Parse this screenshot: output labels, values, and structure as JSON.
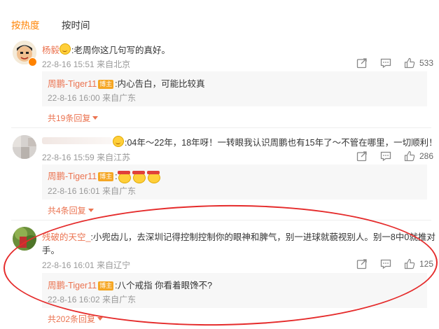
{
  "tabs": {
    "hot": "按热度",
    "time": "按时间"
  },
  "comments": [
    {
      "user": "杨毅",
      "text": ":老周你这几句写的真好。",
      "time": "22-8-16 15:51",
      "location": "来自北京",
      "likes": "533",
      "reply": {
        "user": "周鹏-Tiger11",
        "badge": "博主",
        "text": ":内心告白，可能比较真",
        "time": "22-8-16 16:00",
        "location": "来自广东"
      },
      "more": "共19条回复"
    },
    {
      "user": "",
      "text": ":04年～22年，18年呀！一转眼我认识周鹏也有15年了～不管在哪里，一切顺利！",
      "time": "22-8-16 15:59",
      "location": "来自江苏",
      "likes": "286",
      "reply": {
        "user": "周鹏-Tiger11",
        "badge": "博主",
        "text": ":",
        "time": "22-8-16 16:01",
        "location": "来自广东"
      },
      "more": "共4条回复"
    },
    {
      "user": "残破的天空_",
      "text": ":小兜齿儿，去深圳记得控制控制你的眼神和脾气，别一进球就藐视别人。别一8中0就推对",
      "text2": "手。",
      "time": "22-8-16 16:01",
      "location": "来自辽宁",
      "likes": "125",
      "reply": {
        "user": "周鹏-Tiger11",
        "badge": "博主",
        "text": ":八个戒指  你看着眼馋不?",
        "time": "22-8-16 16:02",
        "location": "来自广东"
      },
      "more": "共202条回复"
    }
  ],
  "icons": {
    "share": "share-icon",
    "comment": "comment-icon",
    "like": "like-icon"
  },
  "colors": {
    "accent": "#ff8200",
    "name": "#eb7350",
    "annotation": "#e52b2b"
  }
}
